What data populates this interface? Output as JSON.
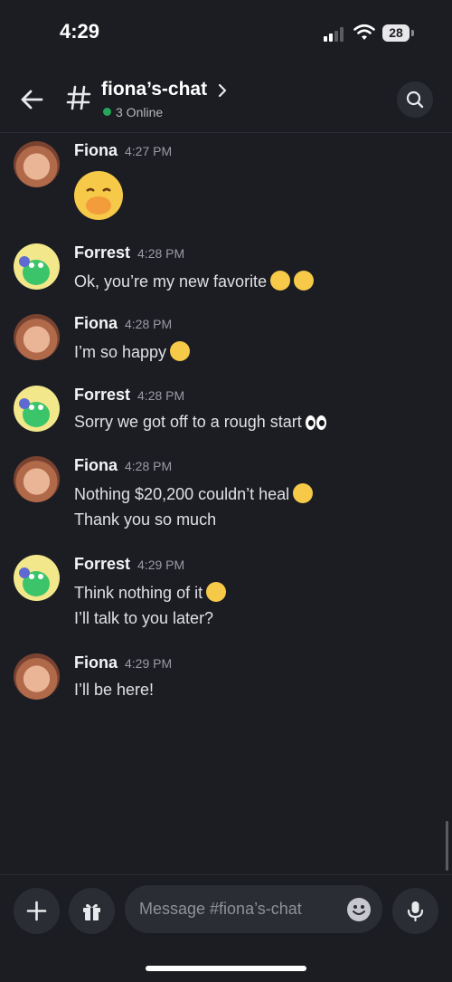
{
  "status_bar": {
    "time": "4:29",
    "battery": "28"
  },
  "header": {
    "channel_name": "fiona’s-chat",
    "online_status": "3 Online"
  },
  "messages": [
    {
      "author": "Fiona",
      "time": "4:27 PM",
      "lines": []
    },
    {
      "author": "Forrest",
      "time": "4:28 PM",
      "lines": [
        "Ok, you’re my new favorite"
      ]
    },
    {
      "author": "Fiona",
      "time": "4:28 PM",
      "lines": [
        "I’m so happy"
      ]
    },
    {
      "author": "Forrest",
      "time": "4:28 PM",
      "lines": [
        "Sorry we got off to a rough start"
      ]
    },
    {
      "author": "Fiona",
      "time": "4:28 PM",
      "lines": [
        "Nothing $20,200 couldn’t heal",
        "Thank you so much"
      ]
    },
    {
      "author": "Forrest",
      "time": "4:29 PM",
      "lines": [
        "Think nothing of it",
        "I’ll talk to you later?"
      ]
    },
    {
      "author": "Fiona",
      "time": "4:29 PM",
      "lines": [
        "I’ll be here!"
      ]
    }
  ],
  "composer": {
    "placeholder": "Message #fiona’s-chat"
  }
}
